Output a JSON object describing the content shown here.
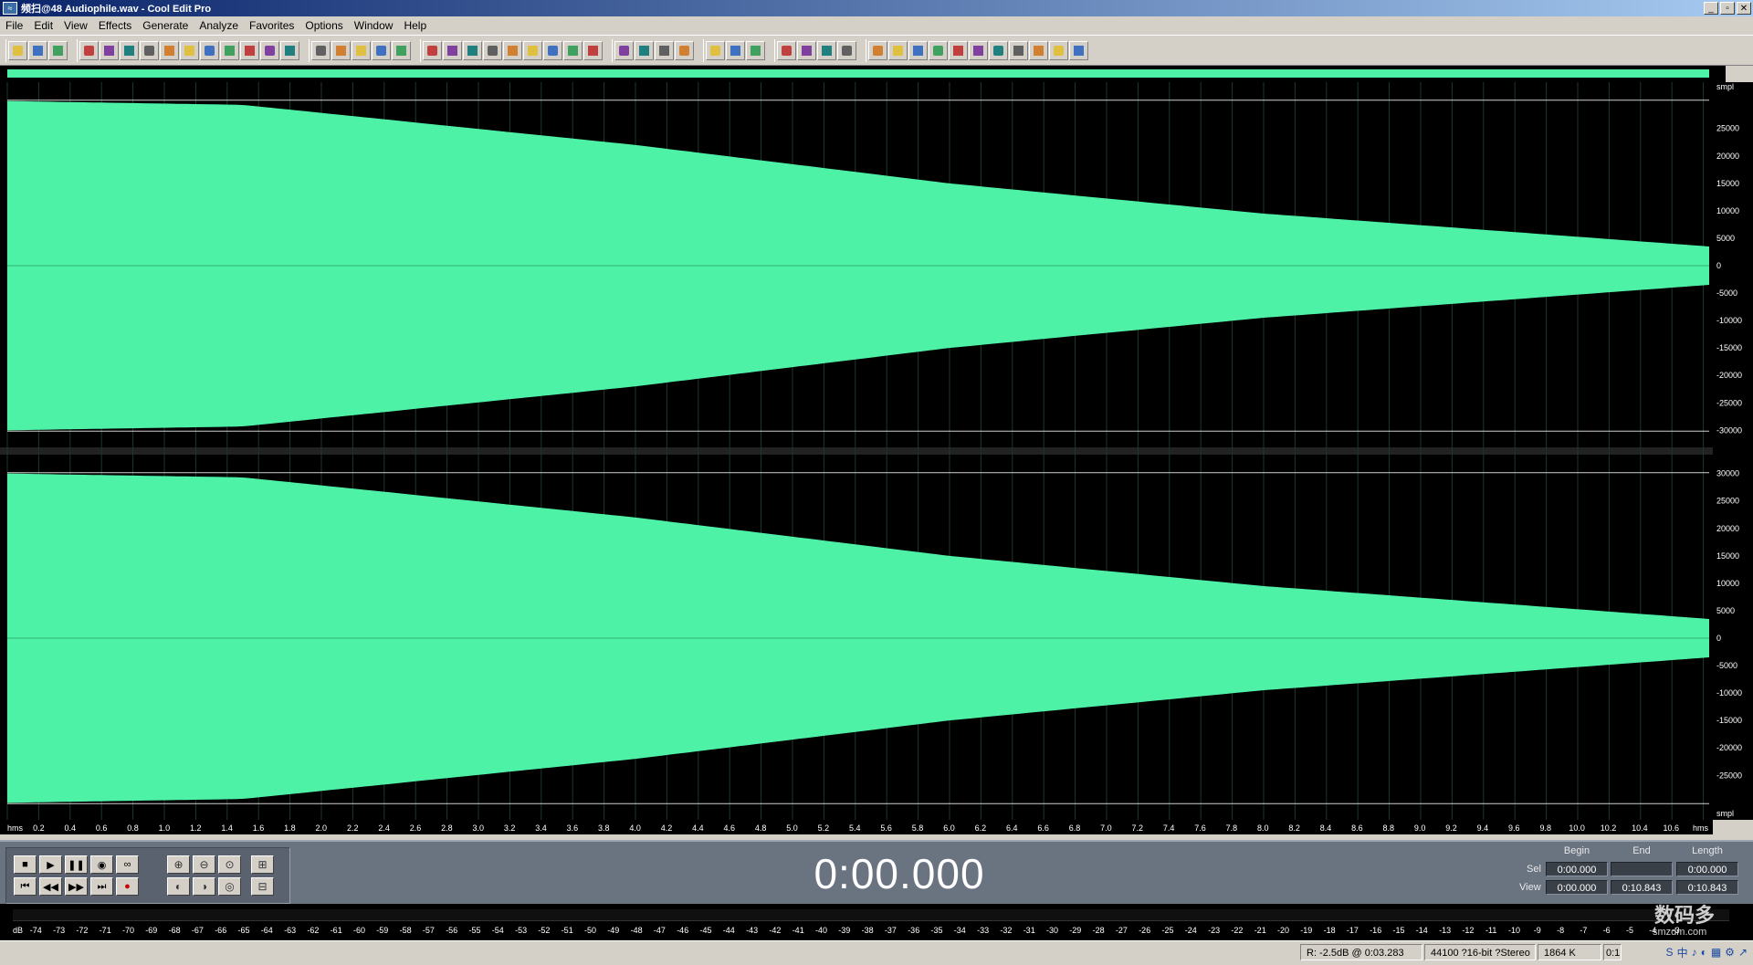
{
  "window": {
    "title": "频扫@48 Audiophile.wav - Cool Edit Pro",
    "minimize": "_",
    "maximize": "▫",
    "close": "✕"
  },
  "menu": [
    "File",
    "Edit",
    "View",
    "Effects",
    "Generate",
    "Analyze",
    "Favorites",
    "Options",
    "Window",
    "Help"
  ],
  "amplitude_ruler": {
    "unit_top": "smpl",
    "unit_bottom": "smpl",
    "channel1_labels": [
      "25000",
      "20000",
      "15000",
      "10000",
      "5000",
      "0",
      "-5000",
      "-10000",
      "-15000",
      "-20000",
      "-25000",
      "-30000"
    ],
    "channel2_labels": [
      "30000",
      "25000",
      "20000",
      "15000",
      "10000",
      "5000",
      "0",
      "-5000",
      "-10000",
      "-15000",
      "-20000",
      "-25000"
    ]
  },
  "time_ruler": {
    "start": "hms",
    "end": "hms",
    "labels": [
      "0.2",
      "0.4",
      "0.6",
      "0.8",
      "1.0",
      "1.2",
      "1.4",
      "1.6",
      "1.8",
      "2.0",
      "2.2",
      "2.4",
      "2.6",
      "2.8",
      "3.0",
      "3.2",
      "3.4",
      "3.6",
      "3.8",
      "4.0",
      "4.2",
      "4.4",
      "4.6",
      "4.8",
      "5.0",
      "5.2",
      "5.4",
      "5.6",
      "5.8",
      "6.0",
      "6.2",
      "6.4",
      "6.6",
      "6.8",
      "7.0",
      "7.2",
      "7.4",
      "7.6",
      "7.8",
      "8.0",
      "8.2",
      "8.4",
      "8.6",
      "8.8",
      "9.0",
      "9.2",
      "9.4",
      "9.6",
      "9.8",
      "10.0",
      "10.2",
      "10.4",
      "10.6"
    ]
  },
  "waveform": {
    "color": "#4ef2a6",
    "duration_s": 10.843,
    "envelope": [
      {
        "t": 0.0,
        "amp": 30000
      },
      {
        "t": 1.5,
        "amp": 29300
      },
      {
        "t": 4.0,
        "amp": 22000
      },
      {
        "t": 6.0,
        "amp": 15000
      },
      {
        "t": 8.0,
        "amp": 9500
      },
      {
        "t": 10.843,
        "amp": 3500
      }
    ]
  },
  "transport": {
    "display_time": "0:00.000",
    "buttons": [
      "stop",
      "play",
      "pause",
      "play-to-end",
      "loop",
      "go-to-start",
      "rewind",
      "fast-forward",
      "go-to-end",
      "record"
    ]
  },
  "selection": {
    "headers": {
      "begin": "Begin",
      "end": "End",
      "length": "Length"
    },
    "sel_label": "Sel",
    "view_label": "View",
    "sel": {
      "begin": "0:00.000",
      "end": "",
      "length": "0:00.000"
    },
    "view": {
      "begin": "0:00.000",
      "end": "0:10.843",
      "length": "0:10.843"
    }
  },
  "level_meter": {
    "labels": [
      "dB",
      "-74",
      "-73",
      "-72",
      "-71",
      "-70",
      "-69",
      "-68",
      "-67",
      "-66",
      "-65",
      "-64",
      "-63",
      "-62",
      "-61",
      "-60",
      "-59",
      "-58",
      "-57",
      "-56",
      "-55",
      "-54",
      "-53",
      "-52",
      "-51",
      "-50",
      "-49",
      "-48",
      "-47",
      "-46",
      "-45",
      "-44",
      "-43",
      "-42",
      "-41",
      "-40",
      "-39",
      "-38",
      "-37",
      "-36",
      "-35",
      "-34",
      "-33",
      "-32",
      "-31",
      "-30",
      "-29",
      "-28",
      "-27",
      "-26",
      "-25",
      "-24",
      "-23",
      "-22",
      "-21",
      "-20",
      "-19",
      "-18",
      "-17",
      "-16",
      "-15",
      "-14",
      "-13",
      "-12",
      "-11",
      "-10",
      "-9",
      "-8",
      "-7",
      "-6",
      "-5",
      "-4",
      "-3"
    ]
  },
  "status": {
    "cursor": "R: -2.5dB @  0:03.283",
    "format": "44100 ?16-bit ?Stereo",
    "size": "1864 K",
    "extra": "0:1"
  },
  "watermark": {
    "main": "数码多",
    "sub": "smzdm.com"
  },
  "tray": [
    "S",
    "中",
    "♪",
    "◐",
    "▦",
    "⚙",
    "↗"
  ]
}
